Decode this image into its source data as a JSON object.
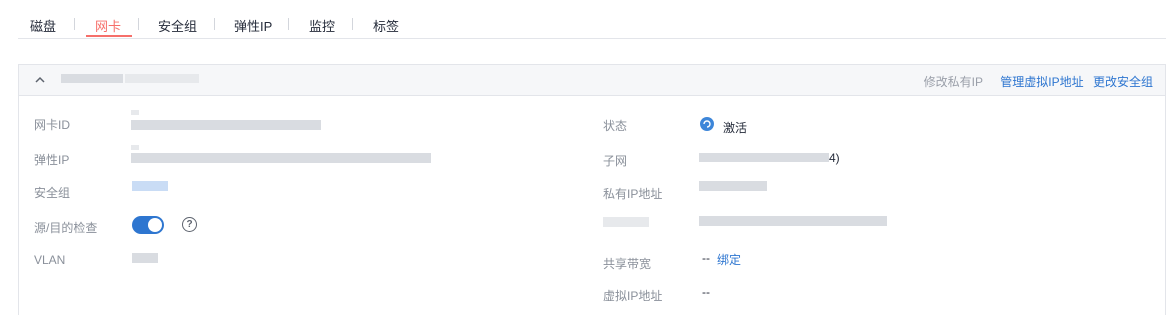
{
  "tabs": [
    {
      "label": "磁盘"
    },
    {
      "label": "网卡",
      "active": true
    },
    {
      "label": "安全组"
    },
    {
      "label": "弹性IP"
    },
    {
      "label": "监控"
    },
    {
      "label": "标签"
    }
  ],
  "panel": {
    "header_actions": {
      "modify_private_ip": "修改私有IP",
      "manage_virtual_ip": "管理虚拟IP地址",
      "change_security_group": "更改安全组"
    },
    "left_fields": {
      "nic_id_label": "网卡ID",
      "eip_label": "弹性IP",
      "security_group_label": "安全组",
      "source_dest_check_label": "源/目的检查",
      "vlan_label": "VLAN"
    },
    "right_fields": {
      "status_label": "状态",
      "status_value": "激活",
      "subnet_label": "子网",
      "subnet_suffix": "4)",
      "private_ip_label": "私有IP地址",
      "shared_bandwidth_label": "共享带宽",
      "shared_bandwidth_value": "--",
      "bind_link": "绑定",
      "virtual_ip_label": "虚拟IP地址",
      "virtual_ip_value": "--"
    },
    "source_dest_check_enabled": true
  },
  "colors": {
    "active_tab": "#f66f6a",
    "link": "#2e76d0",
    "toggle_on": "#2e76d0"
  },
  "icons": [
    "chevron-up-icon",
    "help-circle-icon",
    "status-active-icon"
  ]
}
